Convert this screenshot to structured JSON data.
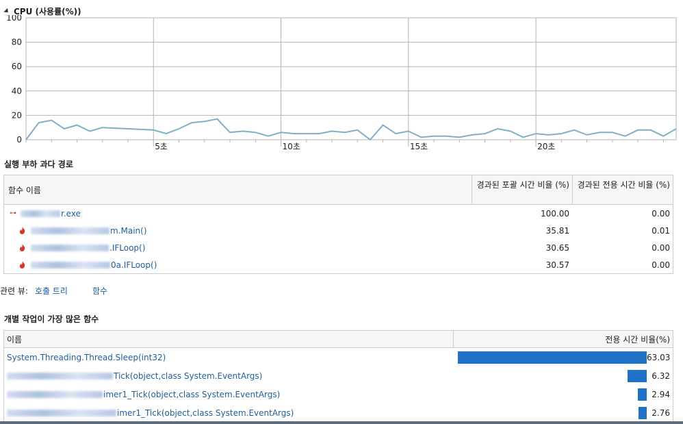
{
  "cpu": {
    "title": "CPU (사용률(%))",
    "chart_data": {
      "type": "line",
      "title": "CPU (사용률(%))",
      "x_unit": "seconds",
      "xlim": [
        0,
        25.5
      ],
      "ylim": [
        0,
        100
      ],
      "y_ticks": [
        0,
        20,
        40,
        60,
        80,
        100
      ],
      "y_tick_labels": [
        "0",
        "20",
        "40",
        "60",
        "80",
        "100"
      ],
      "x_ticks": [
        5,
        10,
        15,
        20
      ],
      "x_tick_labels": [
        "5초",
        "10초",
        "15초",
        "20초"
      ],
      "grid": true,
      "line_color": "#7fafc7",
      "series": [
        {
          "x": [
            0,
            0.5,
            1.0,
            1.5,
            2.0,
            2.5,
            3.0,
            4.0,
            5.0,
            5.5,
            6.0,
            6.5,
            7.0,
            7.5,
            8.0,
            8.5,
            9.0,
            9.5,
            10.0,
            10.5,
            11.0,
            11.5,
            12.0,
            12.5,
            13.0,
            13.5,
            14.0,
            14.5,
            15.0,
            15.5,
            16.0,
            16.5,
            17.0,
            17.5,
            18.0,
            18.5,
            19.0,
            19.5,
            20.0,
            20.5,
            21.0,
            21.5,
            22.0,
            22.5,
            23.0,
            23.5,
            24.0,
            24.5,
            25.0,
            25.5
          ],
          "values": [
            0,
            14,
            16,
            9,
            12,
            7,
            10,
            9,
            8,
            5,
            9,
            14,
            15,
            17,
            6,
            7,
            6,
            3,
            6,
            5,
            5,
            5,
            7,
            6,
            8,
            0,
            12,
            5,
            7,
            2,
            3,
            3,
            2,
            4,
            5,
            9,
            7,
            2,
            5,
            4,
            5,
            8,
            4,
            6,
            6,
            3,
            8,
            8,
            3,
            9
          ]
        }
      ]
    }
  },
  "hot_path": {
    "title": "실행 부하 과다 경로",
    "columns": {
      "name": "함수 이름",
      "inclusive": "경과된 포괄 시간 비율 (%)",
      "exclusive": "경과된 전용 시간 비율 (%)"
    },
    "rows": [
      {
        "name_visible": "r.exe",
        "inclusive": "100.00",
        "exclusive": "0.00"
      },
      {
        "name_visible": "m.Main()",
        "inclusive": "35.81",
        "exclusive": "0.01"
      },
      {
        "name_visible": ".IFLoop()",
        "inclusive": "30.65",
        "exclusive": "0.00"
      },
      {
        "name_visible": "0a.IFLoop()",
        "inclusive": "30.57",
        "exclusive": "0.00"
      }
    ]
  },
  "related": {
    "label": "관련 뷰:",
    "links": [
      "호출 트리",
      "함수"
    ]
  },
  "functions": {
    "title": "개별 작업이 가장 많은 함수",
    "columns": {
      "name": "이름",
      "pct": "전용 시간 비율(%)"
    },
    "rows": [
      {
        "name_visible": "System.Threading.Thread.Sleep(int32)",
        "value": 63.03,
        "label": "63.03"
      },
      {
        "name_visible": "Tick(object,class System.EventArgs)",
        "value": 6.32,
        "label": "6.32"
      },
      {
        "name_visible": "imer1_Tick(object,class System.EventArgs)",
        "value": 2.94,
        "label": "2.94"
      },
      {
        "name_visible": "imer1_Tick(object,class System.EventArgs)",
        "value": 2.76,
        "label": "2.76"
      }
    ]
  }
}
